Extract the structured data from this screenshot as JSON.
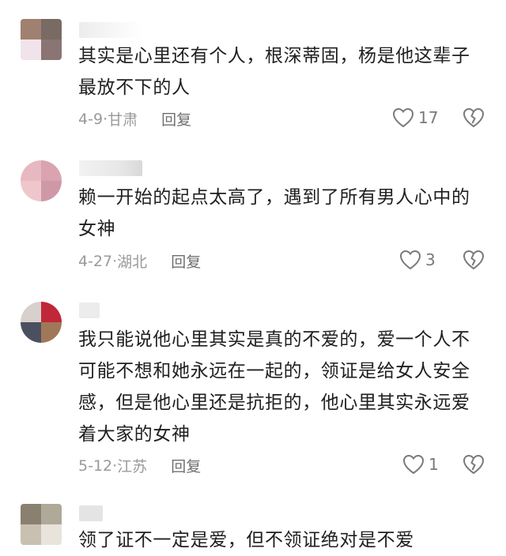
{
  "comments": [
    {
      "text": "其实是心里还有个人，根深蒂固，杨是他这辈子最放不下的人",
      "date": "4-9",
      "location": "甘肃",
      "reply_label": "回复",
      "likes": "17",
      "avatar_colors": [
        "#a08070",
        "#bfa5a0",
        "#f0e4ea",
        "#8a7474"
      ]
    },
    {
      "text": "赖一开始的起点太高了，遇到了所有男人心中的女神",
      "date": "4-27",
      "location": "湖北",
      "reply_label": "回复",
      "likes": "3",
      "avatar_colors": [
        "#e8b8c0",
        "#d9a4b0",
        "#efc6cc",
        "#cf98a6"
      ]
    },
    {
      "text": "我只能说他心里其实是真的不爱的，爱一个人不可能不想和她永远在一起的，领证是给女人安全感，但是他心里还是抗拒的，他心里其实永远爱着大家的女神",
      "date": "5-12",
      "location": "江苏",
      "reply_label": "回复",
      "likes": "1",
      "avatar_colors": [
        "#d8d0cc",
        "#c0283a",
        "#4a5060",
        "#a07858"
      ]
    },
    {
      "text": "领了证不一定是爱，但不领证绝对是不爱",
      "avatar_colors": [
        "#8a8070",
        "#b0a898",
        "#c8c0b0",
        "#e8e4dc"
      ]
    }
  ],
  "separator": "·",
  "colors": {
    "text": "#1f1f1f",
    "meta": "#9a9a9a",
    "icon": "#7a7a7a"
  }
}
